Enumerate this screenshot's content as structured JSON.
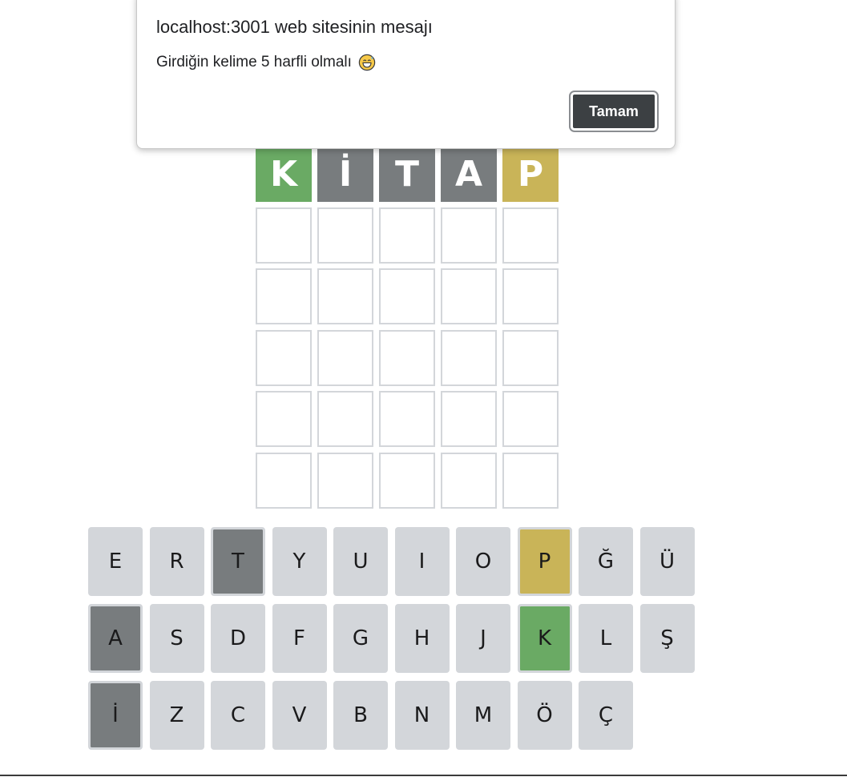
{
  "dialog": {
    "title": "localhost:3001 web sitesinin mesajı",
    "message": "Girdiğin kelime 5 harfli olmalı",
    "message_icon": "grinning-sweat-emoji-icon",
    "ok_label": "Tamam"
  },
  "colors": {
    "correct": "#6aaa64",
    "present": "#c9b458",
    "absent": "#787c7e",
    "empty_border": "#d3d6da",
    "key_default": "#d3d6da",
    "dialog_button": "#3c4043"
  },
  "board": {
    "rows": [
      [
        {
          "letter": "K",
          "state": "correct"
        },
        {
          "letter": "İ",
          "state": "absent"
        },
        {
          "letter": "T",
          "state": "absent"
        },
        {
          "letter": "A",
          "state": "absent"
        },
        {
          "letter": "P",
          "state": "present"
        }
      ],
      [
        {
          "letter": "",
          "state": "empty"
        },
        {
          "letter": "",
          "state": "empty"
        },
        {
          "letter": "",
          "state": "empty"
        },
        {
          "letter": "",
          "state": "empty"
        },
        {
          "letter": "",
          "state": "empty"
        }
      ],
      [
        {
          "letter": "",
          "state": "empty"
        },
        {
          "letter": "",
          "state": "empty"
        },
        {
          "letter": "",
          "state": "empty"
        },
        {
          "letter": "",
          "state": "empty"
        },
        {
          "letter": "",
          "state": "empty"
        }
      ],
      [
        {
          "letter": "",
          "state": "empty"
        },
        {
          "letter": "",
          "state": "empty"
        },
        {
          "letter": "",
          "state": "empty"
        },
        {
          "letter": "",
          "state": "empty"
        },
        {
          "letter": "",
          "state": "empty"
        }
      ],
      [
        {
          "letter": "",
          "state": "empty"
        },
        {
          "letter": "",
          "state": "empty"
        },
        {
          "letter": "",
          "state": "empty"
        },
        {
          "letter": "",
          "state": "empty"
        },
        {
          "letter": "",
          "state": "empty"
        }
      ],
      [
        {
          "letter": "",
          "state": "empty"
        },
        {
          "letter": "",
          "state": "empty"
        },
        {
          "letter": "",
          "state": "empty"
        },
        {
          "letter": "",
          "state": "empty"
        },
        {
          "letter": "",
          "state": "empty"
        }
      ]
    ]
  },
  "keyboard": {
    "rows": [
      [
        {
          "key": "E",
          "state": "default"
        },
        {
          "key": "R",
          "state": "default"
        },
        {
          "key": "T",
          "state": "absent"
        },
        {
          "key": "Y",
          "state": "default"
        },
        {
          "key": "U",
          "state": "default"
        },
        {
          "key": "I",
          "state": "default"
        },
        {
          "key": "O",
          "state": "default"
        },
        {
          "key": "P",
          "state": "present"
        },
        {
          "key": "Ğ",
          "state": "default"
        },
        {
          "key": "Ü",
          "state": "default"
        }
      ],
      [
        {
          "key": "A",
          "state": "absent"
        },
        {
          "key": "S",
          "state": "default"
        },
        {
          "key": "D",
          "state": "default"
        },
        {
          "key": "F",
          "state": "default"
        },
        {
          "key": "G",
          "state": "default"
        },
        {
          "key": "H",
          "state": "default"
        },
        {
          "key": "J",
          "state": "default"
        },
        {
          "key": "K",
          "state": "correct"
        },
        {
          "key": "L",
          "state": "default"
        },
        {
          "key": "Ş",
          "state": "default"
        }
      ],
      [
        {
          "key": "İ",
          "state": "absent"
        },
        {
          "key": "Z",
          "state": "default"
        },
        {
          "key": "C",
          "state": "default"
        },
        {
          "key": "V",
          "state": "default"
        },
        {
          "key": "B",
          "state": "default"
        },
        {
          "key": "N",
          "state": "default"
        },
        {
          "key": "M",
          "state": "default"
        },
        {
          "key": "Ö",
          "state": "default"
        },
        {
          "key": "Ç",
          "state": "default"
        }
      ]
    ]
  }
}
